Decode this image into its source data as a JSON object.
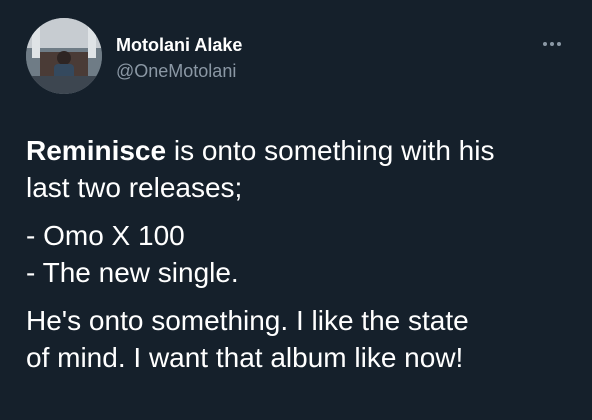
{
  "author": {
    "name": "Motolani Alake",
    "handle": "@OneMotolani"
  },
  "tweet": {
    "mention": "Reminisce",
    "line1_rest": " is onto something with his",
    "line2": "last two releases;",
    "list_item_1": "- Omo X 100",
    "list_item_2": "- The new single.",
    "para3_line1": "He's onto something. I like the state",
    "para3_line2": "of mind. I want that album like now!"
  },
  "colors": {
    "background": "#15202b",
    "text_primary": "#ffffff",
    "text_secondary": "#8b98a5"
  },
  "icons": {
    "more": "more-horizontal-icon"
  }
}
